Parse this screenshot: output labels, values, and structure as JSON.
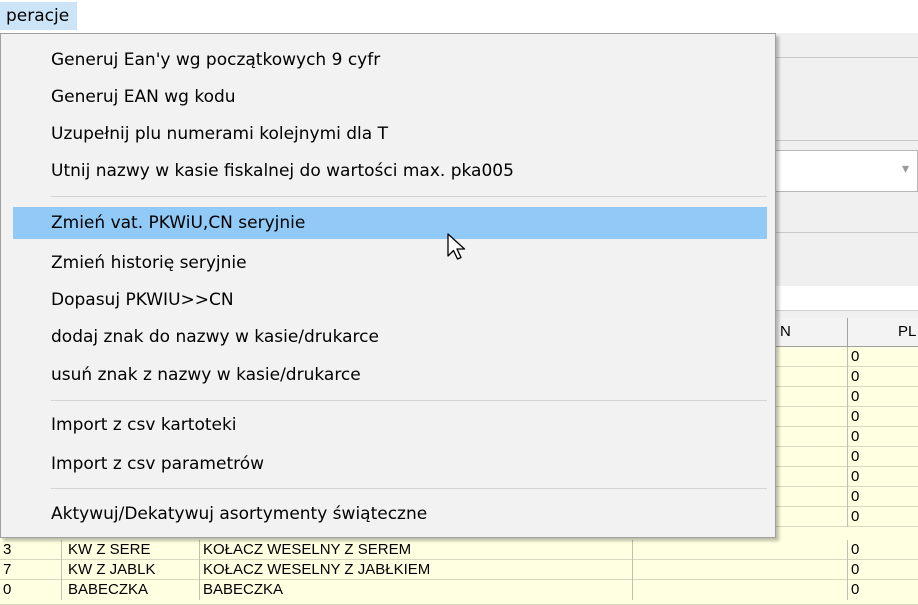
{
  "menubar": {
    "active_item": "peracje"
  },
  "menu": {
    "items": [
      "Generuj Ean'y wg początkowych 9 cyfr",
      "Generuj EAN wg kodu",
      "Uzupełnij plu numerami kolejnymi dla T",
      "Utnij nazwy w kasie fiskalnej do wartości max. pka005",
      "Zmień vat. PKWiU,CN seryjnie",
      "Zmień historię seryjnie",
      "Dopasuj PKWIU>>CN",
      "dodaj znak do nazwy w kasie/drukarce",
      "usuń znak z nazwy w kasie/drukarce",
      "Import z csv kartoteki",
      "Import z csv parametrów",
      "Aktywuj/Dekatywuj asortymenty świąteczne"
    ],
    "highlighted_index": 4
  },
  "grid": {
    "headers": [
      "N",
      "PL"
    ],
    "pl_values": [
      "0",
      "0",
      "0",
      "0",
      "0",
      "0",
      "0",
      "0",
      "0",
      "0",
      "0"
    ],
    "rows": [
      {
        "num": "3",
        "code": "KW Z SERE",
        "name": "KOŁACZ WESELNY Z SEREM",
        "pl": "0"
      },
      {
        "num": "7",
        "code": "KW Z JABLK",
        "name": "KOŁACZ WESELNY Z JABŁKIEM",
        "pl": "0"
      },
      {
        "num": "0",
        "code": "BABECZKA",
        "name": "BABECZKA",
        "pl": "0"
      }
    ]
  },
  "colors": {
    "highlight": "#91c9f7",
    "menubar_active": "#cce4f7",
    "grid_bg": "#ffffe1"
  }
}
